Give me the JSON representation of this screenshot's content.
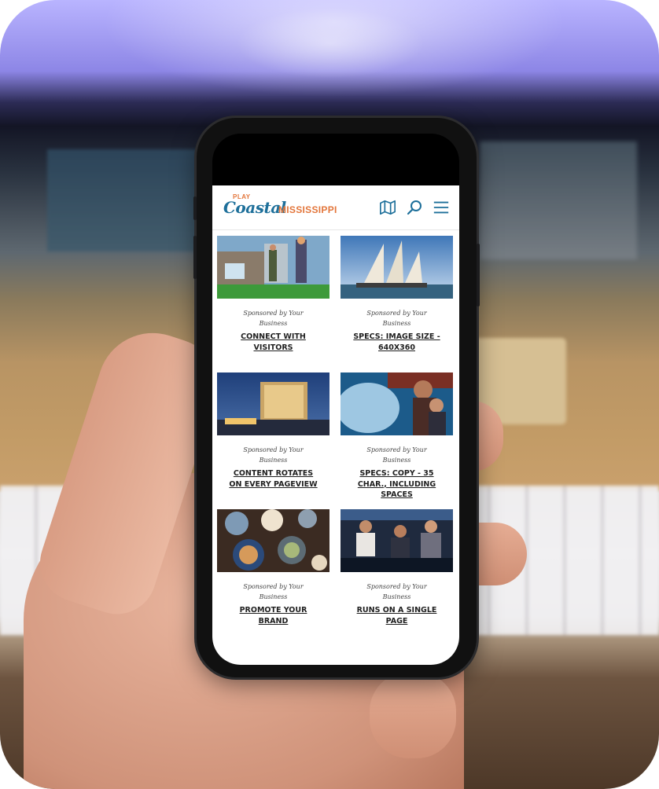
{
  "site": {
    "logo_play": "PLAY",
    "logo_coastal": "Coastal",
    "logo_state": "MISSISSIPPI"
  },
  "header_icons": [
    "map-icon",
    "search-icon",
    "hamburger-menu-icon"
  ],
  "colors": {
    "brand_blue": "#1d6f9a",
    "brand_orange": "#e3763b",
    "headline_text": "#1f1f1f"
  },
  "cards": [
    {
      "sponsor": "Sponsored by Your Business",
      "headline": "CONNECT WITH VISITORS",
      "image": "mini-golf-photo"
    },
    {
      "sponsor": "Sponsored by Your Business",
      "headline": "SPECS: IMAGE SIZE - 640X360",
      "image": "sailboat-photo"
    },
    {
      "sponsor": "Sponsored by Your Business",
      "headline": "CONTENT ROTATES ON EVERY PAGEVIEW",
      "image": "casino-hotel-photo"
    },
    {
      "sponsor": "Sponsored by Your Business",
      "headline": "SPECS: COPY - 35 CHAR., INCLUDING SPACES",
      "image": "aquarium-photo"
    },
    {
      "sponsor": "Sponsored by Your Business",
      "headline": "PROMOTE YOUR BRAND",
      "image": "food-table-photo"
    },
    {
      "sponsor": "Sponsored by Your Business",
      "headline": "RUNS ON A SINGLE PAGE",
      "image": "casino-friends-photo"
    }
  ]
}
